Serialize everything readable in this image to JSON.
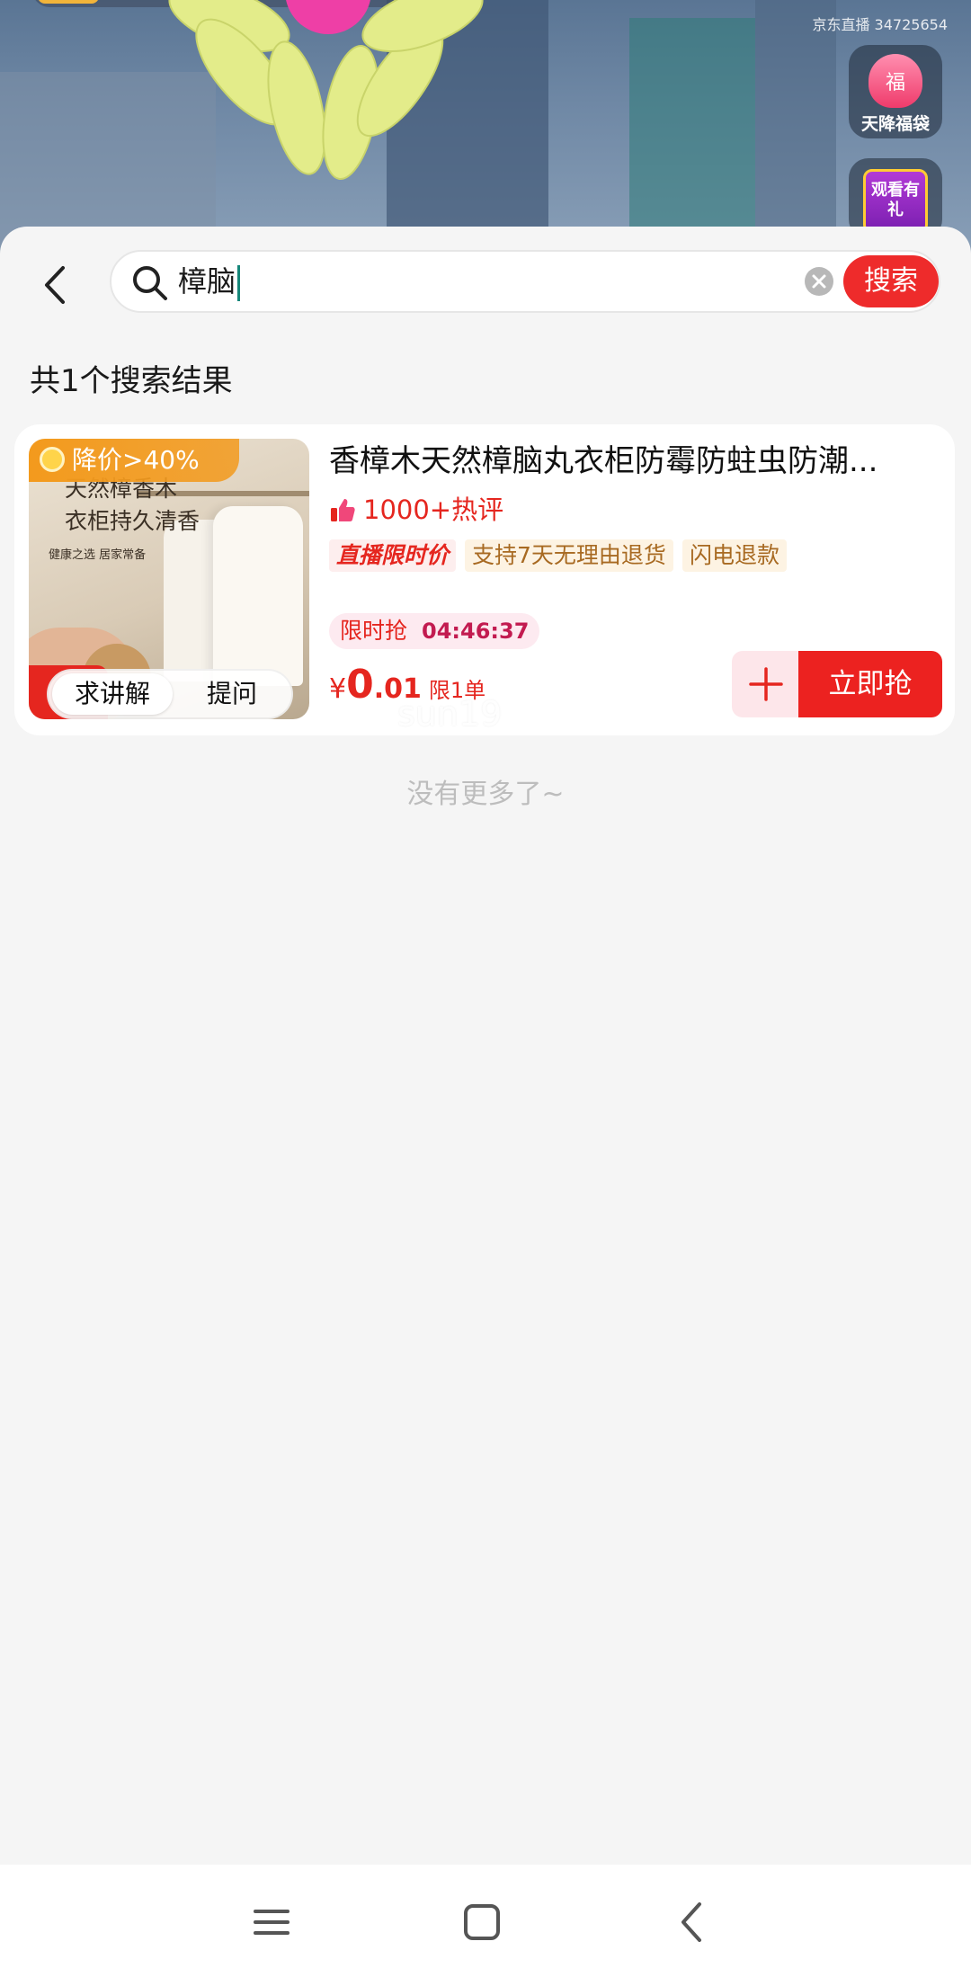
{
  "live": {
    "room_id": "京东直播 34725654",
    "fudai_icon_text": "福",
    "fudai_label": "天降福袋",
    "watch_gift_text": "观看有礼"
  },
  "search": {
    "query": "樟脑",
    "button_label": "搜索"
  },
  "results": {
    "count_text": "共1个搜索结果",
    "end_text": "没有更多了~"
  },
  "product": {
    "discount_badge": "降价>40%",
    "image_text_line1": "天然樟香木",
    "image_text_line2": "衣柜持久清香",
    "image_text_line3": "健康之选 居家常备",
    "ask_explain_label": "求讲解",
    "ask_question_label": "提问",
    "title": "香樟木天然樟脑丸衣柜防霉防蛀虫防潮...",
    "reviews": "1000+热评",
    "tags": [
      "直播限时价",
      "支持7天无理由退货",
      "闪电退款"
    ],
    "flash_sale_label": "限时抢",
    "flash_sale_countdown": "04:46:37",
    "price_currency": "¥",
    "price_integer": "0",
    "price_decimal": ".01",
    "purchase_limit": "限1单",
    "buy_label": "立即抢"
  },
  "watermark": "sun19",
  "colors": {
    "accent_red": "#ec2220",
    "discount_orange": "#f39a1d",
    "page_bg": "#f5f5f5"
  },
  "icons": {
    "back": "chevron-left-icon",
    "search": "search-icon",
    "clear": "clear-icon",
    "thumb": "thumb-up-icon",
    "add": "plus-icon",
    "nav_menu": "menu-icon",
    "nav_home": "home-square-icon",
    "nav_back": "back-icon"
  }
}
